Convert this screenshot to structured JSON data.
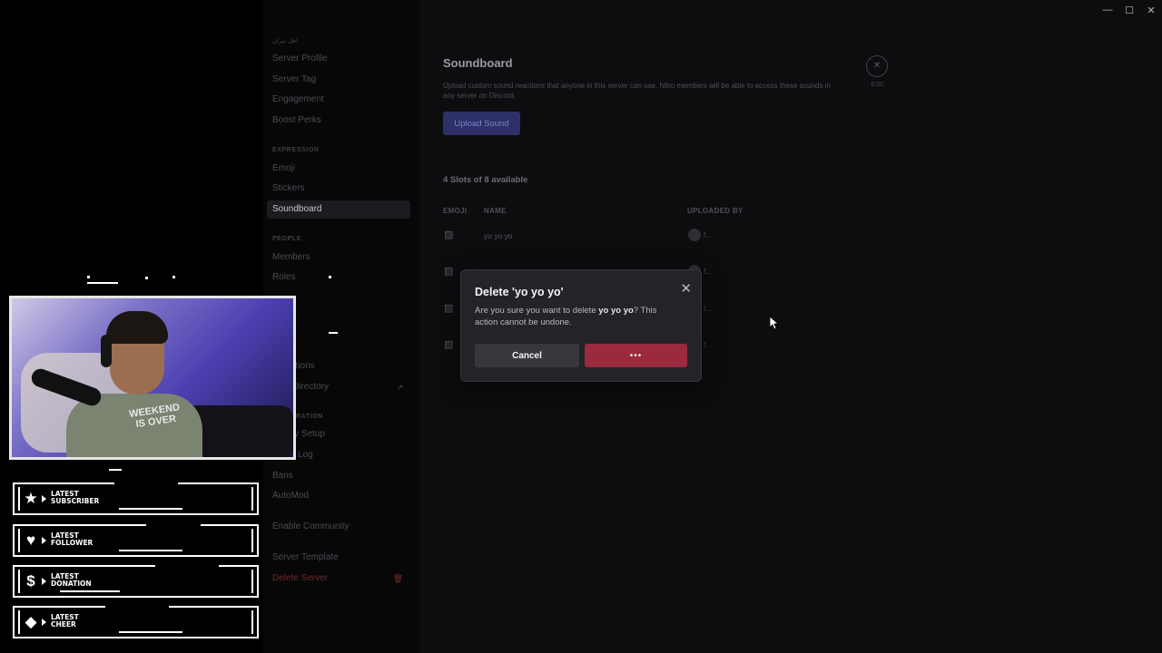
{
  "window_controls": [
    "—",
    "☐",
    "✕"
  ],
  "sidebar": {
    "top_label": "اهل بيزان",
    "items_top": [
      "Server Profile",
      "Server Tag",
      "Engagement",
      "Boost Perks"
    ],
    "expression_header": "EXPRESSION",
    "expression_items": [
      "Emoji",
      "Stickers",
      "Soundboard"
    ],
    "people_header": "PEOPLE",
    "people_items": [
      "Members",
      "Roles"
    ],
    "partial_items": [
      "ations",
      "Directory"
    ],
    "moderation_header_partial": "RATION",
    "moderation_items_partial": [
      "y Setup",
      "Log"
    ],
    "moderation_items": [
      "Bans",
      "AutoMod"
    ],
    "community": "Enable Community",
    "template": "Server Template",
    "delete_server": "Delete Server"
  },
  "main": {
    "title": "Soundboard",
    "description": "Upload custom sound reactions that anyone in this server can use. Nitro members will be able to access these sounds in any server on Discord.",
    "upload_button": "Upload Sound",
    "esc_label": "ESC",
    "slots": "4 Slots of 8 available",
    "columns": {
      "emoji": "EMOJI",
      "name": "NAME",
      "uploaded_by": "UPLOADED BY"
    },
    "rows": [
      {
        "name": "yo yo yo",
        "user": "f..."
      },
      {
        "name": "",
        "user": "f..."
      },
      {
        "name": "",
        "user": "f..."
      },
      {
        "name": "",
        "user": "f..."
      }
    ]
  },
  "modal": {
    "title": "Delete 'yo yo yo'",
    "text_before": "Are you sure you want to delete ",
    "text_bold": "yo yo yo",
    "text_after": "? This action cannot be undone.",
    "cancel": "Cancel",
    "confirm_loading": "•••"
  },
  "overlay": {
    "shirt_text": "WEEKEND IS OVER",
    "alerts": [
      {
        "icon": "star-icon",
        "line1": "LATEST",
        "line2": "SUBSCRIBER"
      },
      {
        "icon": "heart-icon",
        "line1": "LATEST",
        "line2": "FOLLOWER"
      },
      {
        "icon": "dollar-icon",
        "line1": "LATEST",
        "line2": "DONATION"
      },
      {
        "icon": "diamond-icon",
        "line1": "LATEST",
        "line2": "CHEER"
      }
    ]
  },
  "colors": {
    "accent": "#2e3068",
    "danger": "#9b2a3f",
    "modal_bg": "#242428"
  }
}
